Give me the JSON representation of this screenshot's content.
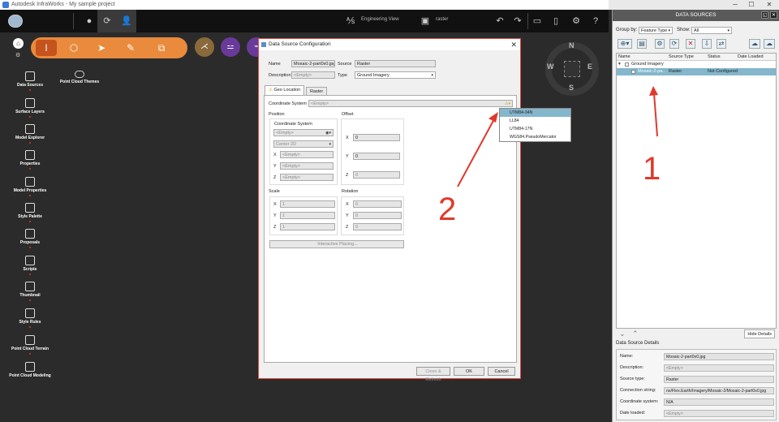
{
  "window": {
    "title": "Autodesk InfraWorks - My sample project",
    "controls": [
      "─",
      "☐",
      "✕"
    ]
  },
  "topbar": {
    "view_mode": "Engineering View",
    "layer_name": "raster"
  },
  "leftnav": {
    "items": [
      {
        "label": "Data Sources"
      },
      {
        "label": "Surface Layers"
      },
      {
        "label": "Model Explorer"
      },
      {
        "label": "Properties"
      },
      {
        "label": "Model Properties"
      },
      {
        "label": "Style Palette"
      },
      {
        "label": "Proposals"
      },
      {
        "label": "Scripts"
      },
      {
        "label": "Thumbnail"
      },
      {
        "label": "Style Rules"
      },
      {
        "label": "Point Cloud Terrain"
      },
      {
        "label": "Point Cloud Modeling"
      }
    ],
    "side_item": "Point Cloud Themes"
  },
  "compass": {
    "n": "N",
    "s": "S",
    "e": "E",
    "w": "W"
  },
  "data_sources_panel": {
    "title": "DATA SOURCES",
    "group_by_label": "Group by:",
    "group_by_value": "Feature Type",
    "show_label": "Show:",
    "show_value": "All",
    "columns": [
      "Name",
      "Source Type",
      "Status",
      "Date Loaded"
    ],
    "group_row": "Ground Imagery",
    "rows": [
      {
        "name": "Mosaic-2-pa...",
        "source_type": "Raster",
        "status": "Not Configured",
        "date_loaded": ""
      }
    ],
    "hide_details": "Hide Details",
    "details_title": "Data Source Details",
    "details": [
      {
        "key": "Name:",
        "value": "Mosaic-2-part0x0.jpg"
      },
      {
        "key": "Description:",
        "value": "<Empty>"
      },
      {
        "key": "Source type:",
        "value": "Raster"
      },
      {
        "key": "Connection string:",
        "value": "nx/Flex.Earth/Imagery/Mosaic-2/Mosaic-2-part0x0.jpg"
      },
      {
        "key": "Coordinate system:",
        "value": "N/A"
      },
      {
        "key": "Date loaded:",
        "value": "<Empty>"
      }
    ]
  },
  "dialog": {
    "title": "Data Source Configuration",
    "name_label": "Name",
    "name_value": "Mosaic-2-part0x0.jpg",
    "source_label": "Source",
    "source_value": "Raster",
    "description_label": "Description",
    "description_value": "<Empty>",
    "type_label": "Type",
    "type_value": "Ground Imagery",
    "tabs": [
      "Geo Location",
      "Raster"
    ],
    "coord_sys_label": "Coordinate System",
    "coord_sys_value": "<Empty>",
    "position_label": "Position",
    "offset_label": "Offset",
    "pos_cs_label": "Coordinate System",
    "pos_cs_value": "<Empty>",
    "pos_center": "Center 2D",
    "pos_x": "<Empty>",
    "pos_y": "<Empty>",
    "pos_z": "<Empty>",
    "offset_x": "0",
    "offset_y": "0",
    "offset_z": "0",
    "scale_label": "Scale",
    "rotation_label": "Rotation",
    "scale_x": "1",
    "scale_y": "1",
    "scale_z": "1",
    "rot_x": "0",
    "rot_y": "0",
    "rot_z": "0",
    "interactive_placing": "Interactive Placing...",
    "buttons": {
      "close_refresh": "Close & Refresh",
      "ok": "OK",
      "cancel": "Cancel"
    }
  },
  "coord_dropdown": {
    "options": [
      "UTM84-34N",
      "LL84",
      "UTM84-17N",
      "WGS84.PseudoMercator"
    ],
    "highlighted": 0
  },
  "annotations": {
    "one": "1",
    "two": "2"
  },
  "colors": {
    "accent_orange": "#e98a3c",
    "selection_blue": "#84b6cc",
    "annotation_red": "#e0392b"
  }
}
